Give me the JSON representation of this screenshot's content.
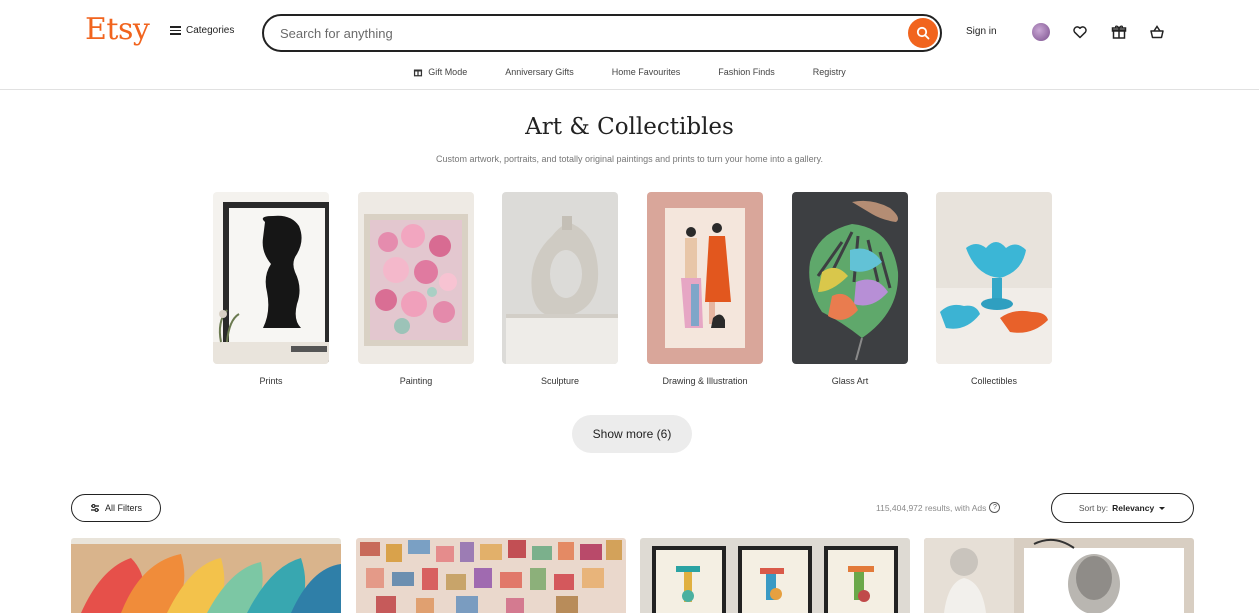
{
  "header": {
    "logo": "Etsy",
    "categories_label": "Categories",
    "search_placeholder": "Search for anything",
    "signin_label": "Sign in"
  },
  "subnav": [
    {
      "label": "Gift Mode",
      "icon": "gift-icon"
    },
    {
      "label": "Anniversary Gifts"
    },
    {
      "label": "Home Favourites"
    },
    {
      "label": "Fashion Finds"
    },
    {
      "label": "Registry"
    }
  ],
  "page": {
    "title": "Art & Collectibles",
    "subtitle": "Custom artwork, portraits, and totally original paintings and prints to turn your home into a gallery."
  },
  "categories": [
    {
      "label": "Prints"
    },
    {
      "label": "Painting"
    },
    {
      "label": "Sculpture"
    },
    {
      "label": "Drawing & Illustration"
    },
    {
      "label": "Glass Art"
    },
    {
      "label": "Collectibles"
    }
  ],
  "show_more_label": "Show more (6)",
  "toolbar": {
    "filters_label": "All Filters",
    "results_text": "115,404,972 results, with Ads",
    "sort_prefix": "Sort by:",
    "sort_value": "Relevancy"
  },
  "colors": {
    "brand": "#f1641e",
    "text": "#222222"
  }
}
